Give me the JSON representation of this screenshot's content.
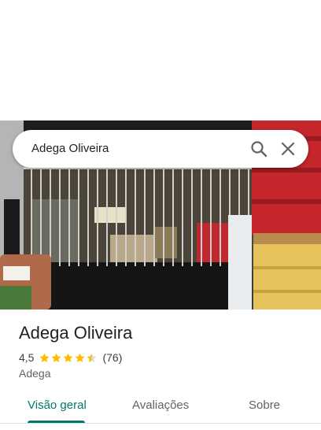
{
  "search": {
    "query": "Adega Oliveira",
    "search_icon": "search-icon",
    "close_icon": "close-icon"
  },
  "photo": {
    "description_icon": "storefront-photo"
  },
  "place": {
    "name": "Adega Oliveira",
    "rating": "4,5",
    "rating_value": 4.5,
    "stars_max": 5,
    "review_count": "(76)",
    "category": "Adega"
  },
  "tabs": [
    {
      "label": "Visão geral",
      "active": true
    },
    {
      "label": "Avaliações",
      "active": false
    },
    {
      "label": "Sobre",
      "active": false
    }
  ],
  "colors": {
    "accent": "#00796b",
    "star": "#fbbc04",
    "star_empty": "#dadce0"
  }
}
